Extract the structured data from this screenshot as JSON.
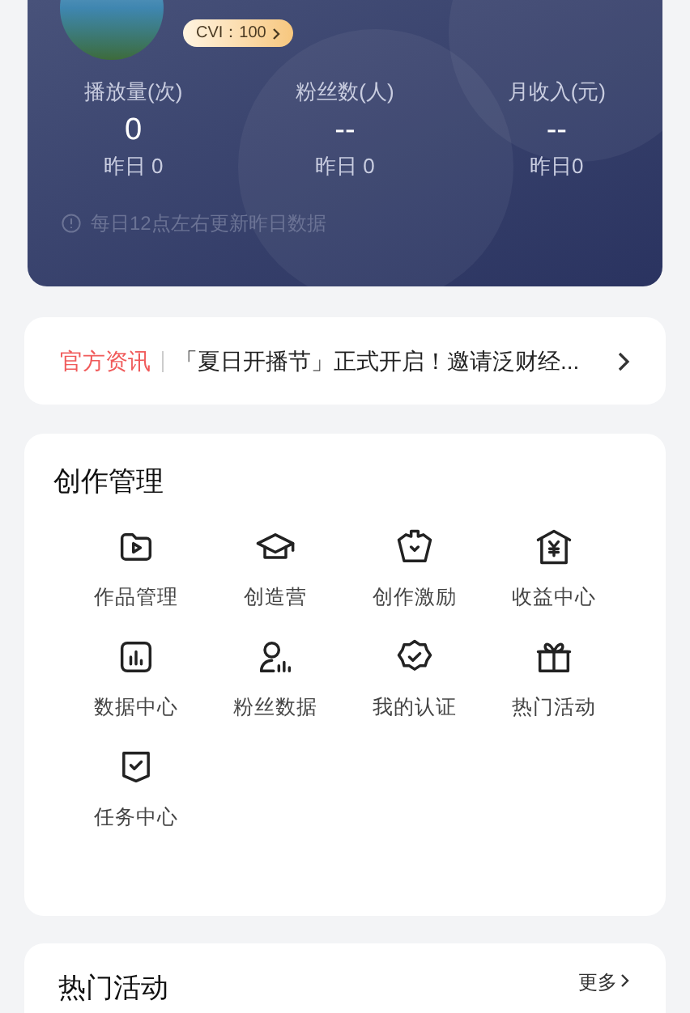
{
  "profile": {
    "cvi_badge": "CVI：100",
    "stats": [
      {
        "label": "播放量(次)",
        "value": "0",
        "yesterday": "昨日 0"
      },
      {
        "label": "粉丝数(人)",
        "value": "--",
        "yesterday": "昨日 0"
      },
      {
        "label": "月收入(元)",
        "value": "--",
        "yesterday": "昨日0"
      }
    ],
    "note": "每日12点左右更新昨日数据"
  },
  "news": {
    "tag": "官方资讯",
    "text": "「夏日开播节」正式开启！邀请泛财经..."
  },
  "creation": {
    "title": "创作管理",
    "items": [
      {
        "kind": "works",
        "label": "作品管理"
      },
      {
        "kind": "camp",
        "label": "创造营"
      },
      {
        "kind": "incentive",
        "label": "创作激励"
      },
      {
        "kind": "income",
        "label": "收益中心"
      },
      {
        "kind": "data",
        "label": "数据中心"
      },
      {
        "kind": "fans",
        "label": "粉丝数据"
      },
      {
        "kind": "cert",
        "label": "我的认证"
      },
      {
        "kind": "gift",
        "label": "热门活动"
      },
      {
        "kind": "task",
        "label": "任务中心"
      }
    ]
  },
  "hot": {
    "title": "热门活动",
    "more": "更多"
  }
}
